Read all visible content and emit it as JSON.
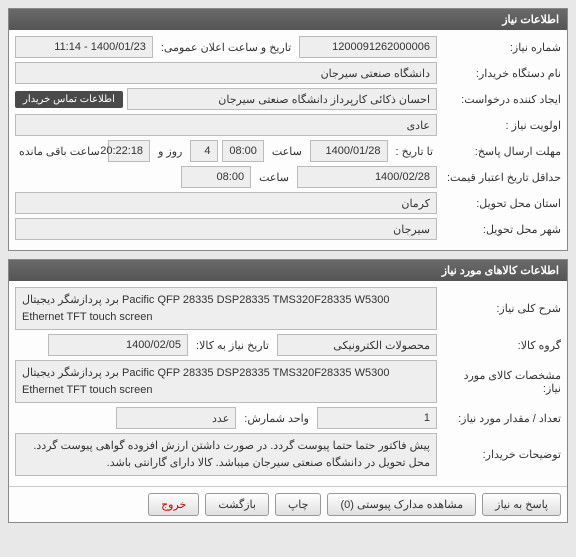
{
  "panel1": {
    "title": "اطلاعات نیاز",
    "reqNoLabel": "شماره نیاز:",
    "reqNo": "1200091262000006",
    "dateTimeLabel": "تاریخ و ساعت اعلان عمومی:",
    "dateTime": "1400/01/23 - 11:14",
    "deviceLabel": "نام دستگاه خریدار:",
    "device": "دانشگاه صنعتی سیرجان",
    "creatorLabel": "ایجاد کننده درخواست:",
    "creator": "احسان ذکائی کارپرداز دانشگاه صنعتی سیرجان",
    "priorityLabel": "اولویت نیاز :",
    "priority": "عادی",
    "deadlineLabel": "مهلت ارسال پاسخ:",
    "toDate": "تا تاریخ :",
    "deadlineDate": "1400/01/28",
    "timeLabel": "ساعت",
    "deadlineTime": "08:00",
    "daysRemain": "4",
    "daysLabel": "روز و",
    "countdown": "20:22:18",
    "remainLabel": "ساعت باقی مانده",
    "minValidLabel": "حداقل تاریخ اعتبار قیمت:",
    "minValidDate": "1400/02/28",
    "minValidTime": "08:00",
    "provinceLabel": "استان محل تحویل:",
    "province": "کرمان",
    "cityLabel": "شهر محل تحویل:",
    "city": "سیرجان",
    "contactBtn": "اطلاعات تماس خریدار"
  },
  "panel2": {
    "title": "اطلاعات کالاهای مورد نیاز",
    "descLabel": "شرح کلی نیاز:",
    "desc": "برد پردازشگر دیجیتال Pacific QFP 28335 DSP28335 TMS320F28335 W5300 Ethernet TFT touch screen",
    "groupLabel": "گروه کالا:",
    "group": "محصولات الکترونیکی",
    "dueLabel": "تاریخ نیاز به کالا:",
    "dueDate": "1400/02/05",
    "specLabel": "مشخصات کالای مورد نیاز:",
    "spec": "برد پردازشگر دیجیتال Pacific QFP 28335 DSP28335 TMS320F28335 W5300 Ethernet TFT touch screen",
    "qtyLabel": "تعداد / مقدار مورد نیاز:",
    "qty": "1",
    "unitLabel": "واحد شمارش:",
    "unit": "عدد",
    "notesLabel": "توضیحات خریدار:",
    "notes": "پیش فاکتور حتما حتما پیوست گردد. در صورت داشتن ارزش افزوده گواهی پیوست گردد. محل تحویل در دانشگاه صنعتی سیرجان میباشد. کالا دارای گارانتی باشد."
  },
  "buttons": {
    "reply": "پاسخ به نیاز",
    "attach": "مشاهده مدارک پیوستی",
    "attachCount": "(0)",
    "print": "چاپ",
    "back": "بازگشت",
    "close": "خروج"
  }
}
